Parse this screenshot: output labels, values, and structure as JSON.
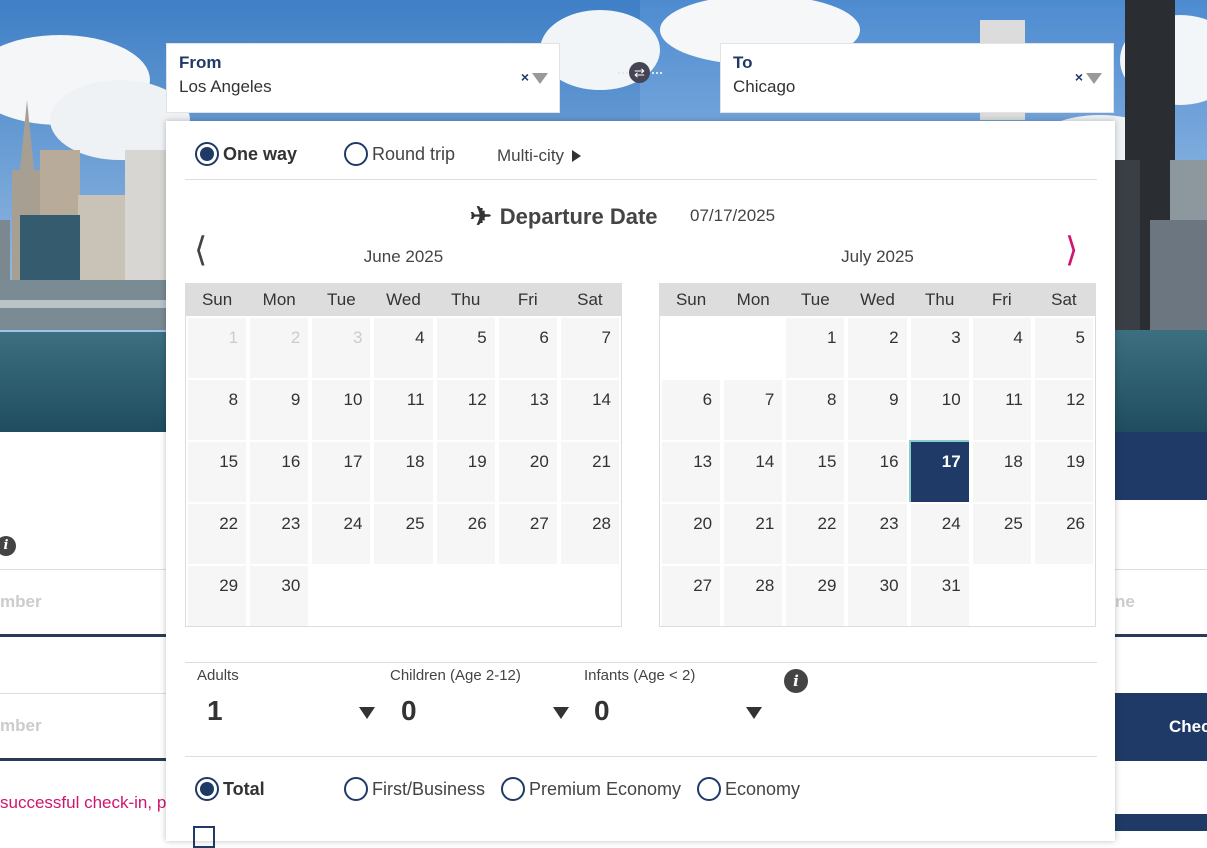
{
  "route": {
    "from": {
      "label": "From",
      "value": "Los Angeles",
      "clear": "×"
    },
    "to": {
      "label": "To",
      "value": "Chicago",
      "clear": "×"
    },
    "swap_icon": "⇄"
  },
  "trip_type": {
    "options": [
      "One way",
      "Round trip"
    ],
    "multi_city": "Multi-city",
    "selected": "One way"
  },
  "departure": {
    "title": "Departure Date",
    "date": "07/17/2025",
    "icon": "✈"
  },
  "nav": {
    "prev": "⟨",
    "next": "⟩"
  },
  "weekdays": [
    "Sun",
    "Mon",
    "Tue",
    "Wed",
    "Thu",
    "Fri",
    "Sat"
  ],
  "months": [
    {
      "title": "June 2025",
      "days": [
        "1",
        "2",
        "3",
        "4",
        "5",
        "6",
        "7",
        "8",
        "9",
        "10",
        "11",
        "12",
        "13",
        "14",
        "15",
        "16",
        "17",
        "18",
        "19",
        "20",
        "21",
        "22",
        "23",
        "24",
        "25",
        "26",
        "27",
        "28",
        "29",
        "30"
      ]
    },
    {
      "title": "July 2025",
      "days": [
        "1",
        "2",
        "3",
        "4",
        "5",
        "6",
        "7",
        "8",
        "9",
        "10",
        "11",
        "12",
        "13",
        "14",
        "15",
        "16",
        "17",
        "18",
        "19",
        "20",
        "21",
        "22",
        "23",
        "24",
        "25",
        "26",
        "27",
        "28",
        "29",
        "30",
        "31"
      ]
    }
  ],
  "passengers": {
    "adults": {
      "label": "Adults",
      "value": "1"
    },
    "children": {
      "label": "Children (Age 2-12)",
      "value": "0"
    },
    "infants": {
      "label": "Infants (Age < 2)",
      "value": "0"
    },
    "info_icon": "i"
  },
  "cabin": {
    "options": [
      "Total",
      "First/Business",
      "Premium Economy",
      "Economy"
    ],
    "selected": "Total"
  },
  "background_page": {
    "field1_placeholder_fragment": "mber",
    "field2_placeholder_fragment": "mber",
    "field3_placeholder_fragment": "ne",
    "check_button_fragment": "Chec",
    "notice_fragment": "successful check-in, p",
    "info_icon": "i"
  },
  "colors": {
    "navy": "#1f3a66",
    "accent_pink": "#d0156f",
    "cell_bg": "#f6f6f6",
    "header_bg": "#dddddd"
  }
}
